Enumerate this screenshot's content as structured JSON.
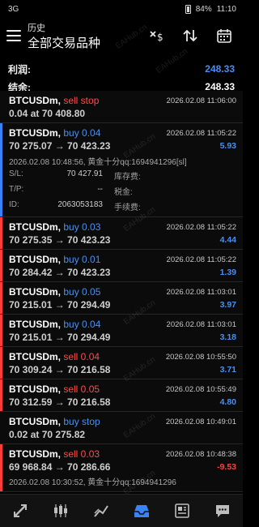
{
  "status_bar": {
    "carrier": "3G",
    "battery": "84%",
    "time": "11:10"
  },
  "header": {
    "subtitle": "历史",
    "title": "全部交易品种"
  },
  "summary": {
    "profit_label": "利润:",
    "profit_value": "248.33",
    "balance_label": "结余:",
    "balance_value": "248.33"
  },
  "trades": [
    {
      "symbol": "BTCUSDm",
      "side": "sell stop",
      "kind": "sell",
      "ts": "2026.02.08 11:06:00",
      "line2": "0.04 at 70 408.80",
      "profit": ""
    },
    {
      "symbol": "BTCUSDm",
      "side": "buy 0.04",
      "kind": "buy",
      "ts": "2026.02.08 11:05:22",
      "line2": "70 275.07 → 70 423.23",
      "profit": "5.93"
    },
    {
      "symbol": "BTCUSDm",
      "side": "buy 0.03",
      "kind": "buy",
      "ts": "2026.02.08 11:05:22",
      "line2": "70 275.35 → 70 423.23",
      "profit": "4.44"
    },
    {
      "symbol": "BTCUSDm",
      "side": "buy 0.01",
      "kind": "buy",
      "ts": "2026.02.08 11:05:22",
      "line2": "70 284.42 → 70 423.23",
      "profit": "1.39"
    },
    {
      "symbol": "BTCUSDm",
      "side": "buy 0.05",
      "kind": "buy",
      "ts": "2026.02.08 11:03:01",
      "line2": "70 215.01 → 70 294.49",
      "profit": "3.97"
    },
    {
      "symbol": "BTCUSDm",
      "side": "buy 0.04",
      "kind": "buy",
      "ts": "2026.02.08 11:03:01",
      "line2": "70 215.01 → 70 294.49",
      "profit": "3.18"
    },
    {
      "symbol": "BTCUSDm",
      "side": "sell 0.04",
      "kind": "sell",
      "ts": "2026.02.08 10:55:50",
      "line2": "70 309.24 → 70 216.58",
      "profit": "3.71"
    },
    {
      "symbol": "BTCUSDm",
      "side": "sell 0.05",
      "kind": "sell",
      "ts": "2026.02.08 10:55:49",
      "line2": "70 312.59 → 70 216.58",
      "profit": "4.80"
    },
    {
      "symbol": "BTCUSDm",
      "side": "buy stop",
      "kind": "buy",
      "ts": "2026.02.08 10:49:01",
      "line2": "0.02 at 70 275.82",
      "profit": ""
    },
    {
      "symbol": "BTCUSDm",
      "side": "sell 0.03",
      "kind": "sell",
      "ts": "2026.02.08 10:48:38",
      "line2": "69 968.84 → 70 286.66",
      "profit": "-9.53"
    }
  ],
  "expanded": {
    "comment": "2026.02.08 10:48:56, 黄金十分qq:1694941296[sl]",
    "sl_label": "S/L:",
    "sl_value": "70 427.91",
    "tp_label": "T/P:",
    "tp_value": "--",
    "id_label": "ID:",
    "id_value": "2063053183",
    "swap_label": "库存费:",
    "tax_label": "税金:",
    "fee_label": "手续费:"
  },
  "last_comment": "2026.02.08 10:30:52, 黄金十分qq:1694941296",
  "watermark": "EAHub.cn",
  "nav": [
    "quotes-icon",
    "chart-icon",
    "trade-icon",
    "history-icon",
    "news-icon",
    "chat-icon"
  ],
  "colors": {
    "buy": "#4a8ff0",
    "sell": "#ff4a4a",
    "loss": "#ff4040",
    "nav_active": "#3b82f6"
  }
}
